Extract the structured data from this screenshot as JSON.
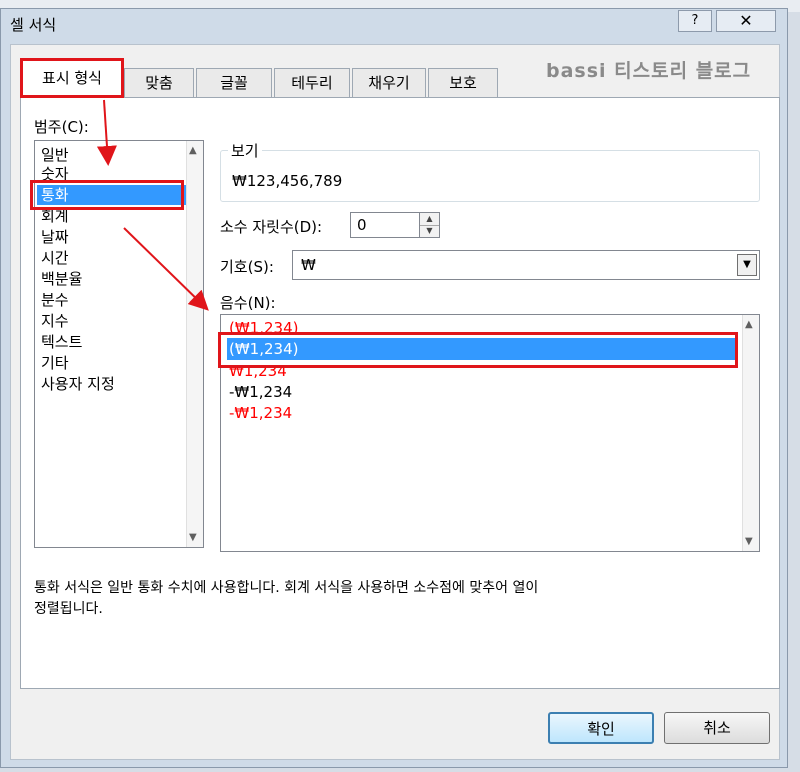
{
  "dialog": {
    "title": "셀 서식",
    "help_label": "?",
    "close_label": "✕",
    "watermark": "bassi 티스토리 블로그"
  },
  "tabs": [
    {
      "label": "표시 형식",
      "active": true
    },
    {
      "label": "맞춤"
    },
    {
      "label": "글꼴"
    },
    {
      "label": "테두리"
    },
    {
      "label": "채우기"
    },
    {
      "label": "보호"
    }
  ],
  "category": {
    "label": "범주(C):",
    "items": [
      "일반",
      "숫자",
      "통화",
      "회계",
      "날짜",
      "시간",
      "백분율",
      "분수",
      "지수",
      "텍스트",
      "기타",
      "사용자 지정"
    ],
    "selected": "통화"
  },
  "sample": {
    "label": "보기",
    "value": "₩123,456,789"
  },
  "decimal": {
    "label": "소수 자릿수(D):",
    "value": "0"
  },
  "symbol": {
    "label": "기호(S):",
    "value": "₩"
  },
  "negative": {
    "label": "음수(N):",
    "items": [
      {
        "text": "(₩1,234)",
        "color": "#ff0000"
      },
      {
        "text": "(₩1,234)",
        "color": "#000000",
        "selected": true
      },
      {
        "text": "₩1,234",
        "color": "#ff0000"
      },
      {
        "text": "-₩1,234",
        "color": "#000000"
      },
      {
        "text": "-₩1,234",
        "color": "#ff0000"
      }
    ]
  },
  "description": {
    "line1": "통화 서식은 일반 통화 수치에 사용합니다. 회계 서식을 사용하면 소수점에 맞추어 열이",
    "line2": "정렬됩니다."
  },
  "buttons": {
    "ok": "확인",
    "cancel": "취소"
  },
  "colors": {
    "highlight": "#3399ff",
    "annotation": "#e0151a"
  }
}
